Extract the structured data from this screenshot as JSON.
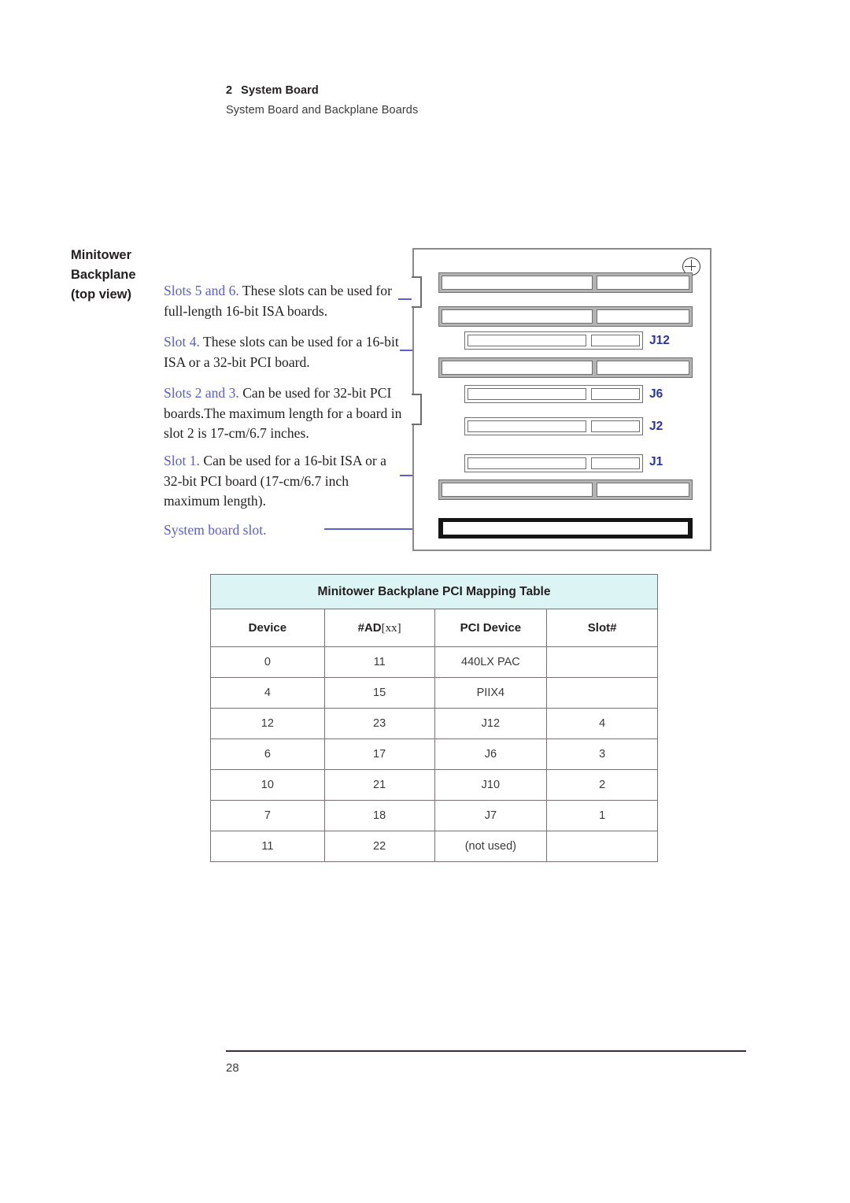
{
  "header": {
    "chapter_number": "2",
    "chapter_title": "System Board",
    "section_title": "System Board and Backplane Boards"
  },
  "margin_heading": {
    "line1": "Minitower",
    "line2": "Backplane",
    "line3": "(top view)"
  },
  "callouts": [
    {
      "label": "Slots 5 and 6.",
      "text": " These slots can be used for full-length 16-bit ISA boards."
    },
    {
      "label": "Slot 4.",
      "text": " These slots can be used for a 16-bit ISA or a 32-bit PCI board."
    },
    {
      "label": "Slots 2 and 3.",
      "text": " Can be used for 32-bit PCI boards.The maximum length for a board in slot 2 is 17-cm/6.7 inches."
    },
    {
      "label": "Slot 1.",
      "text": " Can be used for a 16-bit ISA or a 32-bit PCI board (17-cm/6.7 inch maximum length)."
    },
    {
      "label": "System board slot.",
      "text": ""
    }
  ],
  "diagram": {
    "connector_labels": {
      "j12": "J12",
      "j6": "J6",
      "j2": "J2",
      "j1": "J1"
    },
    "accent_color": "#2b34a0",
    "leader_color": "#5b5fc7"
  },
  "table": {
    "title": "Minitower Backplane PCI Mapping Table",
    "columns": {
      "device": "Device",
      "ad": "#AD",
      "ad_index": "[xx]",
      "pci_device": "PCI Device",
      "slot": "Slot#"
    },
    "rows": [
      {
        "device": "0",
        "ad": "11",
        "pci_device": "440LX PAC",
        "slot": ""
      },
      {
        "device": "4",
        "ad": "15",
        "pci_device": "PIIX4",
        "slot": ""
      },
      {
        "device": "12",
        "ad": "23",
        "pci_device": "J12",
        "slot": "4"
      },
      {
        "device": "6",
        "ad": "17",
        "pci_device": "J6",
        "slot": "3"
      },
      {
        "device": "10",
        "ad": "21",
        "pci_device": "J10",
        "slot": "2"
      },
      {
        "device": "7",
        "ad": "18",
        "pci_device": "J7",
        "slot": "1"
      },
      {
        "device": "11",
        "ad": "22",
        "pci_device": "(not used)",
        "slot": ""
      }
    ]
  },
  "footer": {
    "page_number": "28"
  }
}
